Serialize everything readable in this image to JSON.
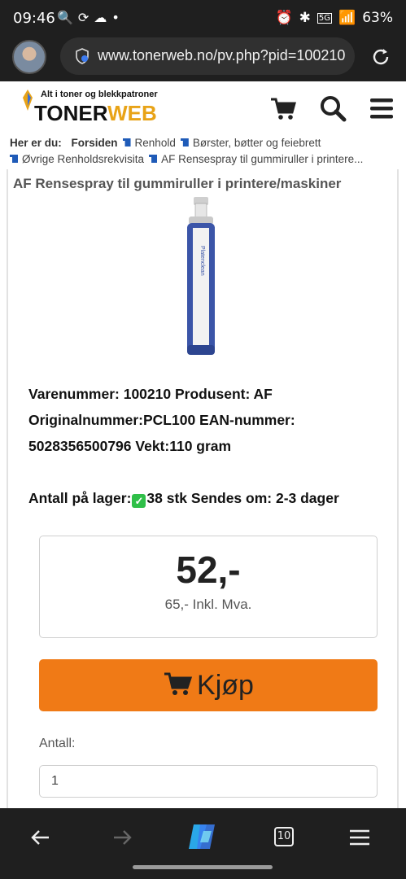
{
  "status_bar": {
    "time": "09:46",
    "battery": "63%",
    "network": "5G"
  },
  "browser": {
    "url": "www.tonerweb.no/pv.php?pid=100210",
    "tab_count": "10"
  },
  "site": {
    "tagline": "Alt i toner og blekkpatroner",
    "logo_part1": "TONER",
    "logo_part2": "WEB"
  },
  "breadcrumb": {
    "prefix": "Her er du:",
    "items": [
      "Forsiden",
      "Renhold",
      "Børster, bøtter og feiebrett",
      "Øvrige Renholdsrekvisita",
      "AF Rensespray til gummiruller i printere..."
    ]
  },
  "product": {
    "title": "AF Rensespray til gummiruller i printere/maskiner",
    "info_line1": "Varenummer: 100210 Produsent: AF",
    "info_line2": "Originalnummer:PCL100 EAN-nummer:",
    "info_line3": "5028356500796 Vekt:110 gram",
    "stock_label": "Antall på lager:",
    "stock_value": "38 stk Sendes om: 2-3 dager",
    "price": "52,-",
    "price_inkl": "65,- Inkl. Mva.",
    "buy_label": "Kjøp",
    "qty_label": "Antall:",
    "qty_value": "1"
  },
  "colors": {
    "accent": "#f07a16",
    "bar": "#1f1f1f",
    "logo_web": "#e8a317",
    "breadcrumb_icon": "#1f5bb8"
  }
}
